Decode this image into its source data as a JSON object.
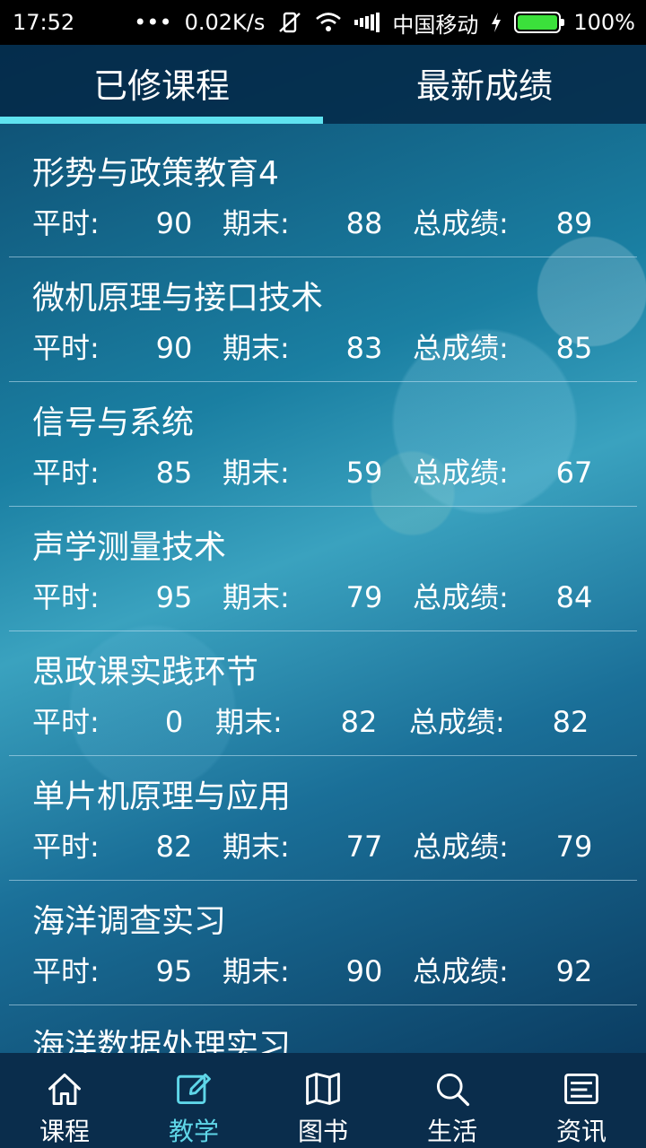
{
  "status_bar": {
    "time": "17:52",
    "dots": "•••",
    "speed": "0.02K/s",
    "carrier": "中国移动",
    "battery": "100%"
  },
  "tabs": [
    {
      "label": "已修课程",
      "active": true
    },
    {
      "label": "最新成绩",
      "active": false
    }
  ],
  "labels": {
    "usual": "平时:",
    "final": "期末:",
    "total": "总成绩:"
  },
  "courses": [
    {
      "name": "形势与政策教育4",
      "usual": "90",
      "final": "88",
      "total": "89"
    },
    {
      "name": "微机原理与接口技术",
      "usual": "90",
      "final": "83",
      "total": "85"
    },
    {
      "name": "信号与系统",
      "usual": "85",
      "final": "59",
      "total": "67"
    },
    {
      "name": "声学测量技术",
      "usual": "95",
      "final": "79",
      "total": "84"
    },
    {
      "name": "思政课实践环节",
      "usual": "0",
      "final": "82",
      "total": "82"
    },
    {
      "name": "单片机原理与应用",
      "usual": "82",
      "final": "77",
      "total": "79"
    },
    {
      "name": "海洋调查实习",
      "usual": "95",
      "final": "90",
      "total": "92"
    },
    {
      "name": "海洋数据处理实习",
      "usual": "",
      "final": "",
      "total": ""
    }
  ],
  "bottom_nav": [
    {
      "label": "课程",
      "icon": "home-icon",
      "active": false
    },
    {
      "label": "教学",
      "icon": "edit-icon",
      "active": true
    },
    {
      "label": "图书",
      "icon": "map-book-icon",
      "active": false
    },
    {
      "label": "生活",
      "icon": "search-icon",
      "active": false
    },
    {
      "label": "资讯",
      "icon": "news-icon",
      "active": false
    }
  ],
  "colors": {
    "accent": "#5fe3f0",
    "tab_bar": "#04284a",
    "nav_bar": "#0a2d4c"
  }
}
